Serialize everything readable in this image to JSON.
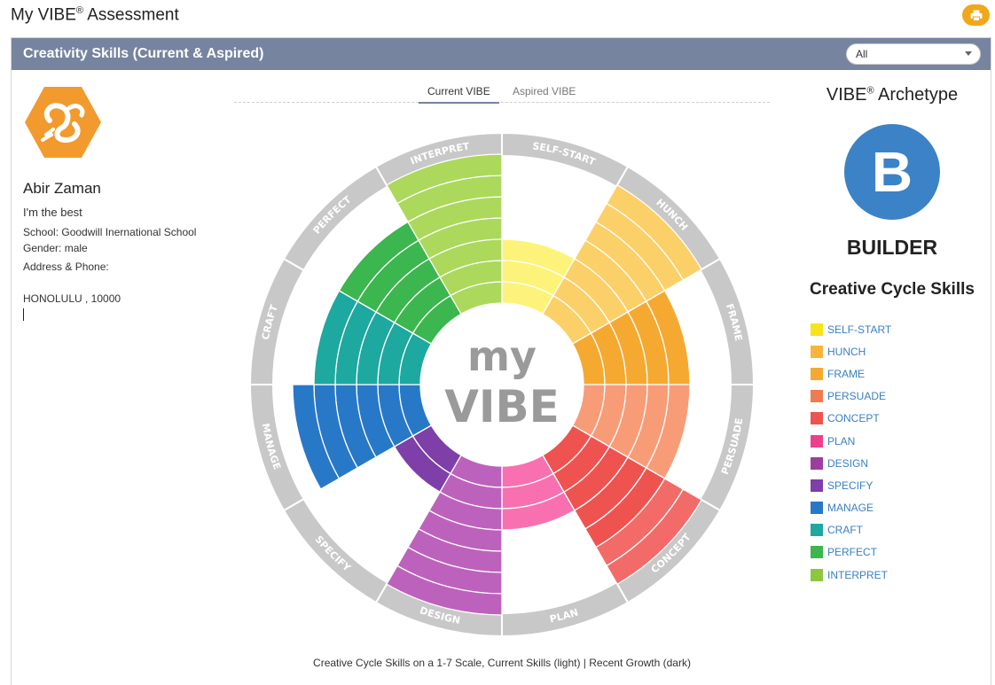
{
  "header": {
    "title": "My VIBE",
    "title_mark": "®",
    "title_suffix": " Assessment",
    "print_icon": "printer-icon"
  },
  "panel": {
    "title": "Creativity Skills (Current & Aspired)",
    "filter_value": "All"
  },
  "profile": {
    "logo_icon": "vibe-logo-hexagon-icon",
    "name": "Abir Zaman",
    "motto": "I'm the best",
    "school": "School: Goodwill Inernational School",
    "gender": "Gender: male",
    "address_label": "Address & Phone:",
    "address": "HONOLULU , 10000"
  },
  "tabs": {
    "current": "Current VIBE",
    "aspired": "Aspired VIBE",
    "active": "current"
  },
  "wheel": {
    "center_line1": "my",
    "center_line2": "VIBE",
    "caption": "Creative Cycle Skills on a 1-7 Scale, Current Skills (light) | Recent Growth (dark)",
    "scale_max": 7,
    "skills": [
      {
        "name": "SELF-START",
        "current": 3,
        "growth": 0,
        "light": "#fdf37a",
        "dark": "#f7e31c"
      },
      {
        "name": "HUNCH",
        "current": 7,
        "growth": 0,
        "light": "#fcd068",
        "dark": "#f8b53c"
      },
      {
        "name": "FRAME",
        "current": 5,
        "growth": 5,
        "light": "#f9b648",
        "dark": "#f5a931"
      },
      {
        "name": "PERSUADE",
        "current": 5,
        "growth": 0,
        "light": "#f89c78",
        "dark": "#f07b4e"
      },
      {
        "name": "CONCEPT",
        "current": 7,
        "growth": 5,
        "light": "#f26b68",
        "dark": "#ee5350"
      },
      {
        "name": "PLAN",
        "current": 3,
        "growth": 0,
        "light": "#f870b0",
        "dark": "#ee3f8d"
      },
      {
        "name": "DESIGN",
        "current": 7,
        "growth": 0,
        "light": "#bd62bc",
        "dark": "#9c3ea1"
      },
      {
        "name": "SPECIFY",
        "current": 2,
        "growth": 2,
        "light": "#9a55b7",
        "dark": "#7e3fa8"
      },
      {
        "name": "MANAGE",
        "current": 6,
        "growth": 6,
        "light": "#3a95db",
        "dark": "#2878c8"
      },
      {
        "name": "CRAFT",
        "current": 5,
        "growth": 5,
        "light": "#37c5c0",
        "dark": "#1da8a0"
      },
      {
        "name": "PERFECT",
        "current": 5,
        "growth": 5,
        "light": "#58d46a",
        "dark": "#3cb64e"
      },
      {
        "name": "INTERPRET",
        "current": 7,
        "growth": 0,
        "light": "#acd85c",
        "dark": "#8dc63f"
      }
    ]
  },
  "archetype": {
    "title": "VIBE",
    "title_mark": "®",
    "title_suffix": " Archetype",
    "letter": "B",
    "name": "BUILDER",
    "color": "#3c82c6"
  },
  "legend": {
    "title": "Creative Cycle Skills",
    "items": [
      {
        "label": "SELF-START",
        "color": "#f7e31c"
      },
      {
        "label": "HUNCH",
        "color": "#f8b53c"
      },
      {
        "label": "FRAME",
        "color": "#f5a931"
      },
      {
        "label": "PERSUADE",
        "color": "#f07b4e"
      },
      {
        "label": "CONCEPT",
        "color": "#ee5350"
      },
      {
        "label": "PLAN",
        "color": "#ee3f8d"
      },
      {
        "label": "DESIGN",
        "color": "#9c3ea1"
      },
      {
        "label": "SPECIFY",
        "color": "#7e3fa8"
      },
      {
        "label": "MANAGE",
        "color": "#2878c8"
      },
      {
        "label": "CRAFT",
        "color": "#1da8a0"
      },
      {
        "label": "PERFECT",
        "color": "#3cb64e"
      },
      {
        "label": "INTERPRET",
        "color": "#8dc63f"
      }
    ]
  }
}
